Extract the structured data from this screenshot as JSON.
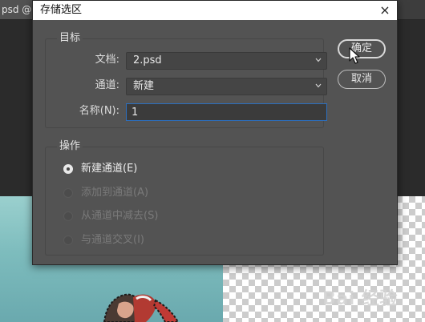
{
  "workspace": {
    "doc_tab_label": "psd @",
    "tab_close": "×"
  },
  "dialog": {
    "title": "存储选区",
    "close_glyph": "×",
    "target_group": {
      "label": "目标",
      "document_label": "文档:",
      "document_value": "2.psd",
      "channel_label": "通道:",
      "channel_value": "新建",
      "name_label": "名称(N):",
      "name_value": "1"
    },
    "operation_group": {
      "label": "操作",
      "options": [
        {
          "label": "新建通道(E)",
          "selected": true,
          "enabled": true
        },
        {
          "label": "添加到通道(A)",
          "selected": false,
          "enabled": false
        },
        {
          "label": "从通道中减去(S)",
          "selected": false,
          "enabled": false
        },
        {
          "label": "与通道交叉(I)",
          "selected": false,
          "enabled": false
        }
      ]
    },
    "buttons": {
      "ok_label": "确定",
      "cancel_label": "取消"
    }
  },
  "watermark_text": "Bai 经验",
  "colors": {
    "dialog_bg": "#535353",
    "focus_border": "#2c6fbf",
    "title_bar": "#ffffff"
  }
}
